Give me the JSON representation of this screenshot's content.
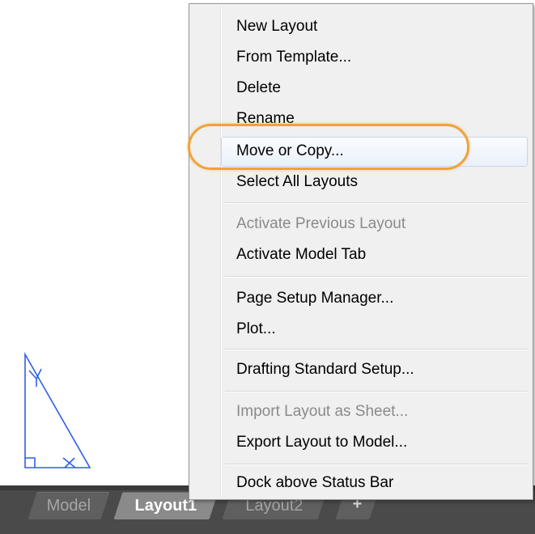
{
  "menu": {
    "items": [
      {
        "label": "New Layout",
        "enabled": true
      },
      {
        "label": "From Template...",
        "enabled": true
      },
      {
        "label": "Delete",
        "enabled": true
      },
      {
        "label": "Rename",
        "enabled": true
      },
      {
        "label": "Move or Copy...",
        "enabled": true,
        "highlighted": true
      },
      {
        "label": "Select All Layouts",
        "enabled": true
      },
      {
        "label": "Activate Previous Layout",
        "enabled": false
      },
      {
        "label": "Activate Model Tab",
        "enabled": true
      },
      {
        "label": "Page Setup Manager...",
        "enabled": true
      },
      {
        "label": "Plot...",
        "enabled": true
      },
      {
        "label": "Drafting Standard Setup...",
        "enabled": true
      },
      {
        "label": "Import Layout as Sheet...",
        "enabled": false
      },
      {
        "label": "Export Layout to Model...",
        "enabled": true
      },
      {
        "label": "Dock above Status Bar",
        "enabled": true
      }
    ]
  },
  "tabs": [
    {
      "label": "Model",
      "active": false
    },
    {
      "label": "Layout1",
      "active": true
    },
    {
      "label": "Layout2",
      "active": false
    },
    {
      "label": "+",
      "active": false
    }
  ],
  "colors": {
    "highlight_ring": "#f0a23a",
    "drawing_stroke": "#2f5ee8",
    "tabbar_bg": "#4a4a4a"
  }
}
